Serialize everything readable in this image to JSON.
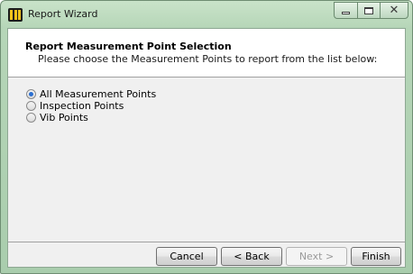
{
  "window": {
    "title": "Report Wizard",
    "close_glyph": "✕"
  },
  "header": {
    "title": "Report Measurement Point Selection",
    "subtitle": "Please choose the Measurement Points to report from the list below:"
  },
  "options": [
    {
      "label": "All Measurement Points",
      "selected": true
    },
    {
      "label": "Inspection Points",
      "selected": false
    },
    {
      "label": "Vib Points",
      "selected": false
    }
  ],
  "buttons": {
    "cancel": "Cancel",
    "back": "< Back",
    "next": "Next >",
    "finish": "Finish"
  },
  "icons": {
    "app": "report-wizard-app-icon",
    "minimize": "minimize-icon",
    "maximize": "maximize-icon",
    "close": "close-icon"
  },
  "colors": {
    "titlebar": "#b6d6b8",
    "radio_selected": "#2a6fd1"
  }
}
